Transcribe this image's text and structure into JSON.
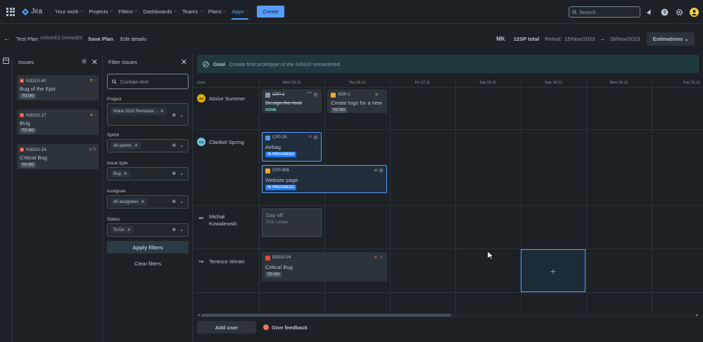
{
  "topnav": {
    "app_name": "Jira",
    "items": [
      {
        "label": "Your work"
      },
      {
        "label": "Projects"
      },
      {
        "label": "Filters"
      },
      {
        "label": "Dashboards"
      },
      {
        "label": "Teams"
      },
      {
        "label": "Plans"
      },
      {
        "label": "Apps",
        "active": true
      }
    ],
    "create_label": "Create",
    "search_placeholder": "Search",
    "icons": [
      "notification-icon",
      "help-icon",
      "settings-icon",
      "profile-avatar"
    ]
  },
  "plan_bar": {
    "title": "Test Plan",
    "unsaved": "UNSAVED CHANGES",
    "save_label": "Save Plan",
    "edit_label": "Edit details",
    "user_initials": "MK",
    "total": "12SP total",
    "period_label": "Period:",
    "period_start": "15/Nov/2023",
    "period_end": "28/Nov/2023",
    "estimations_label": "Estimations"
  },
  "issues_panel": {
    "title": "Issues",
    "cards": [
      {
        "key": "N3310-40",
        "title": "Bug of the Epic",
        "status": "TO DO",
        "priority": "=",
        "estimate": "-"
      },
      {
        "key": "N3310-17",
        "title": "BUg",
        "status": "TO DO",
        "priority": "=",
        "estimate": "-"
      },
      {
        "key": "N3310-24",
        "title": "Critical Bug",
        "status": "TO DO",
        "priority": "≈",
        "estimate": "5"
      }
    ]
  },
  "filter_panel": {
    "title": "Filter Issues",
    "search_placeholder": "Contain text",
    "project_label": "Project",
    "project_value": "Nokia 3310 Remaster...",
    "sprint_label": "Sprint",
    "sprint_value": "All sprints",
    "issue_type_label": "Issue type",
    "issue_type_value": "Bug",
    "assignee_label": "Assignee",
    "assignee_value": "All assignees",
    "status_label": "Status",
    "status_value": "To Do",
    "apply_label": "Apply filters",
    "clear_label": "Clear filters"
  },
  "goal": {
    "label": "Goal",
    "text": "Create first prototype of the N3310 remastered."
  },
  "calendar": {
    "user_col_label": "User",
    "days": [
      "Wed 15.11",
      "Thu 16.11",
      "Fri 17.11",
      "Sat 18.11",
      "Sun 19.11",
      "Mon 20.11",
      "Tue 21.11"
    ],
    "users": [
      {
        "initials": "AS",
        "name": "Aloise Summer",
        "color": "#e2b203"
      },
      {
        "initials": "CS",
        "name": "Claribel Spring",
        "color": "#6cc3e0"
      },
      {
        "initials": "MK",
        "name": "Michał Kowalewski",
        "color": "#1d2125"
      },
      {
        "initials": "TW",
        "name": "Terence Winter",
        "color": "#1d2125"
      }
    ],
    "events": {
      "cfp2": {
        "key": "CFP-2",
        "title": "Design the look",
        "status": "DONE",
        "estimate": "2"
      },
      "adp2": {
        "key": "ADP-2",
        "title": "Create logo for a new ...",
        "status": "TO DO",
        "estimate": "-"
      },
      "cfp35": {
        "key": "CFP-35",
        "title": "Airbag",
        "status": "IN PROGRESS",
        "estimate": "3"
      },
      "cfp909": {
        "key": "CFP-909",
        "title": "Website page",
        "status": "IN PROGRESS",
        "estimate": "2"
      },
      "dayoff": {
        "title": "Day off",
        "subtitle": "Sick Leave"
      },
      "n24": {
        "key": "N3310-24",
        "title": "Critical Bug",
        "status": "TO DO",
        "estimate": "5"
      }
    },
    "add_symbol": "+"
  },
  "footer": {
    "add_user_label": "Add user",
    "feedback_label": "Give feedback"
  }
}
